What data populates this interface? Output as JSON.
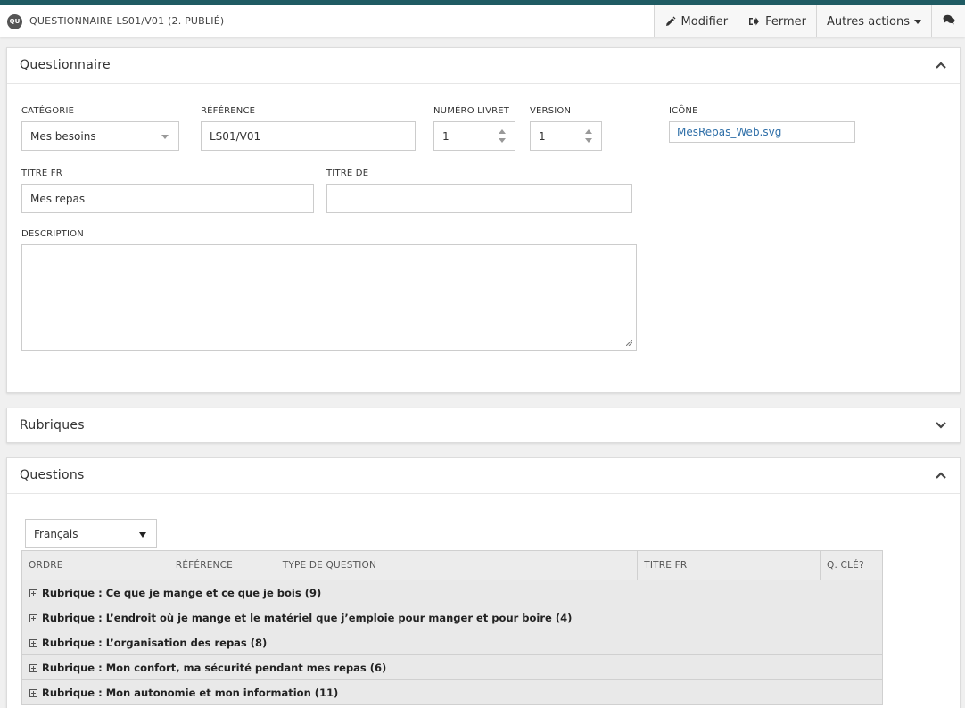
{
  "header": {
    "badge": "QU",
    "title": "QUESTIONNAIRE LS01/V01 (2. PUBLIÉ)",
    "actions": {
      "edit": "Modifier",
      "close": "Fermer",
      "more": "Autres actions"
    }
  },
  "panels": {
    "questionnaire": {
      "title": "Questionnaire",
      "fields": {
        "category_label": "CATÉGORIE",
        "category_value": "Mes besoins",
        "reference_label": "RÉFÉRENCE",
        "reference_value": "LS01/V01",
        "booklet_label": "NUMÉRO LIVRET",
        "booklet_value": "1",
        "version_label": "VERSION",
        "version_value": "1",
        "icon_label": "ICÔNE",
        "icon_value": "MesRepas_Web.svg",
        "title_fr_label": "TITRE FR",
        "title_fr_value": "Mes repas",
        "title_de_label": "TITRE DE",
        "title_de_value": "",
        "description_label": "DESCRIPTION",
        "description_value": ""
      }
    },
    "rubriques": {
      "title": "Rubriques"
    },
    "questions": {
      "title": "Questions",
      "language": "Français",
      "columns": [
        "ORDRE",
        "RÉFÉRENCE",
        "TYPE DE QUESTION",
        "TITRE FR",
        "Q. CLÉ?"
      ],
      "groups": [
        "Rubrique : Ce que je mange et ce que je bois (9)",
        "Rubrique : L’endroit où je mange et le matériel que j’emploie pour manger et pour boire (4)",
        "Rubrique : L’organisation des repas (8)",
        "Rubrique : Mon confort, ma sécurité pendant mes repas (6)",
        "Rubrique : Mon autonomie et mon information (11)"
      ]
    }
  }
}
